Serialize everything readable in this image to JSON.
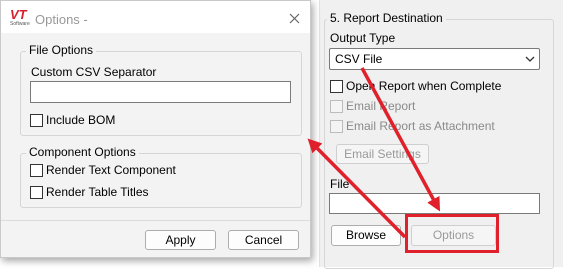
{
  "dialog": {
    "logo_text": "VT",
    "logo_sub": "Software",
    "title": "Options -",
    "file_options": {
      "legend": "File Options",
      "separator_label": "Custom CSV Separator",
      "separator_value": "",
      "include_bom_label": "Include BOM",
      "include_bom_checked": false
    },
    "component_options": {
      "legend": "Component Options",
      "render_text_label": "Render Text Component",
      "render_text_checked": false,
      "render_tables_label": "Render Table Titles",
      "render_tables_checked": false
    },
    "apply_label": "Apply",
    "cancel_label": "Cancel"
  },
  "report_destination": {
    "legend": "5. Report Destination",
    "output_type_label": "Output Type",
    "output_type_value": "CSV File",
    "open_report_label": "Open Report when Complete",
    "email_report_label": "Email Report",
    "email_attachment_label": "Email Report as Attachment",
    "email_settings_label": "Email Settings",
    "file_label": "File",
    "file_value": "",
    "browse_label": "Browse",
    "options_label": "Options"
  },
  "colors": {
    "annotation_red": "#e0202a",
    "logo_red": "#d7202f"
  }
}
